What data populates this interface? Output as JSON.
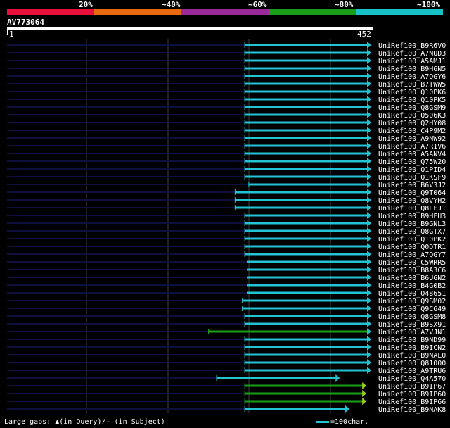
{
  "identity_scale": {
    "ticks": [
      "20%",
      "~40%",
      "~60%",
      "~80%",
      "~100%"
    ],
    "colors": [
      "#e8103a",
      "#e86a10",
      "#9a2a9a",
      "#1a9e1a",
      "#19c2c8"
    ]
  },
  "query": {
    "id": "AV773064",
    "start": "1",
    "end": "452",
    "length": 452
  },
  "hits": [
    {
      "name": "UniRef100_B9R6V0",
      "start": 295,
      "end": 452,
      "color": "#22c4d4",
      "arrow": "#22c4d4"
    },
    {
      "name": "UniRef100_A7NUD3",
      "start": 295,
      "end": 452,
      "color": "#22c4d4",
      "arrow": "#22c4d4"
    },
    {
      "name": "UniRef100_A5AMJ1",
      "start": 295,
      "end": 452,
      "color": "#22c4d4",
      "arrow": "#22c4d4"
    },
    {
      "name": "UniRef100_B9H6N5",
      "start": 295,
      "end": 452,
      "color": "#22c4d4",
      "arrow": "#22c4d4"
    },
    {
      "name": "UniRef100_A7QGY6",
      "start": 295,
      "end": 452,
      "color": "#22c4d4",
      "arrow": "#22c4d4"
    },
    {
      "name": "UniRef100_B7TWW5",
      "start": 295,
      "end": 452,
      "color": "#22c4d4",
      "arrow": "#22c4d4"
    },
    {
      "name": "UniRef100_Q10PK6",
      "start": 295,
      "end": 452,
      "color": "#22c4d4",
      "arrow": "#22c4d4"
    },
    {
      "name": "UniRef100_Q10PK5",
      "start": 295,
      "end": 452,
      "color": "#22c4d4",
      "arrow": "#22c4d4"
    },
    {
      "name": "UniRef100_Q8GSM9",
      "start": 295,
      "end": 452,
      "color": "#22c4d4",
      "arrow": "#22c4d4"
    },
    {
      "name": "UniRef100_Q506K3",
      "start": 295,
      "end": 452,
      "color": "#22c4d4",
      "arrow": "#22c4d4"
    },
    {
      "name": "UniRef100_Q2HY08",
      "start": 295,
      "end": 452,
      "color": "#22c4d4",
      "arrow": "#22c4d4"
    },
    {
      "name": "UniRef100_C4P9M2",
      "start": 295,
      "end": 452,
      "color": "#22c4d4",
      "arrow": "#22c4d4"
    },
    {
      "name": "UniRef100_A9NW92",
      "start": 295,
      "end": 452,
      "color": "#22c4d4",
      "arrow": "#22c4d4"
    },
    {
      "name": "UniRef100_A7R1V6",
      "start": 295,
      "end": 452,
      "color": "#22c4d4",
      "arrow": "#22c4d4"
    },
    {
      "name": "UniRef100_A5ANV4",
      "start": 295,
      "end": 452,
      "color": "#22c4d4",
      "arrow": "#22c4d4"
    },
    {
      "name": "UniRef100_Q75W20",
      "start": 295,
      "end": 452,
      "color": "#22c4d4",
      "arrow": "#22c4d4"
    },
    {
      "name": "UniRef100_Q1PID4",
      "start": 295,
      "end": 452,
      "color": "#22c4d4",
      "arrow": "#22c4d4"
    },
    {
      "name": "UniRef100_Q1KSF9",
      "start": 295,
      "end": 452,
      "color": "#22c4d4",
      "arrow": "#22c4d4"
    },
    {
      "name": "UniRef100_B6V3J2",
      "start": 300,
      "end": 452,
      "color": "#22c4d4",
      "arrow": "#22c4d4"
    },
    {
      "name": "UniRef100_Q9T064",
      "start": 283,
      "end": 452,
      "color": "#22c4d4",
      "arrow": "#22c4d4"
    },
    {
      "name": "UniRef100_Q8VYH2",
      "start": 283,
      "end": 452,
      "color": "#22c4d4",
      "arrow": "#22c4d4"
    },
    {
      "name": "UniRef100_Q8LFJ1",
      "start": 283,
      "end": 452,
      "color": "#22c4d4",
      "arrow": "#22c4d4"
    },
    {
      "name": "UniRef100_B9HFU3",
      "start": 295,
      "end": 452,
      "color": "#22c4d4",
      "arrow": "#22c4d4"
    },
    {
      "name": "UniRef100_B9GNL3",
      "start": 295,
      "end": 452,
      "color": "#22c4d4",
      "arrow": "#22c4d4"
    },
    {
      "name": "UniRef100_Q8GTX7",
      "start": 295,
      "end": 452,
      "color": "#22c4d4",
      "arrow": "#22c4d4"
    },
    {
      "name": "UniRef100_Q10PK2",
      "start": 295,
      "end": 452,
      "color": "#22c4d4",
      "arrow": "#22c4d4"
    },
    {
      "name": "UniRef100_Q0DTR1",
      "start": 295,
      "end": 452,
      "color": "#22c4d4",
      "arrow": "#22c4d4"
    },
    {
      "name": "UniRef100_A7QGY7",
      "start": 295,
      "end": 452,
      "color": "#22c4d4",
      "arrow": "#22c4d4"
    },
    {
      "name": "UniRef100_C5WRR5",
      "start": 298,
      "end": 452,
      "color": "#22c4d4",
      "arrow": "#22c4d4"
    },
    {
      "name": "UniRef100_B8A3C6",
      "start": 298,
      "end": 452,
      "color": "#22c4d4",
      "arrow": "#22c4d4"
    },
    {
      "name": "UniRef100_B6U6N2",
      "start": 298,
      "end": 452,
      "color": "#22c4d4",
      "arrow": "#22c4d4"
    },
    {
      "name": "UniRef100_B4G0B2",
      "start": 298,
      "end": 452,
      "color": "#22c4d4",
      "arrow": "#22c4d4"
    },
    {
      "name": "UniRef100_O48651",
      "start": 298,
      "end": 452,
      "color": "#22c4d4",
      "arrow": "#22c4d4"
    },
    {
      "name": "UniRef100_Q9SM02",
      "start": 292,
      "end": 452,
      "color": "#22c4d4",
      "arrow": "#22c4d4"
    },
    {
      "name": "UniRef100_Q9C649",
      "start": 292,
      "end": 452,
      "color": "#22c4d4",
      "arrow": "#22c4d4"
    },
    {
      "name": "UniRef100_Q8GSM8",
      "start": 295,
      "end": 452,
      "color": "#22c4d4",
      "arrow": "#22c4d4"
    },
    {
      "name": "UniRef100_B9SX91",
      "start": 295,
      "end": 452,
      "color": "#22c4d4",
      "arrow": "#22c4d4"
    },
    {
      "name": "UniRef100_A7VJN1",
      "start": 250,
      "end": 452,
      "color": "#1a9e1a",
      "arrow": "#22c4d4"
    },
    {
      "name": "UniRef100_B9ND99",
      "start": 295,
      "end": 452,
      "color": "#22c4d4",
      "arrow": "#22c4d4"
    },
    {
      "name": "UniRef100_B9ICN2",
      "start": 295,
      "end": 452,
      "color": "#22c4d4",
      "arrow": "#22c4d4"
    },
    {
      "name": "UniRef100_B9NAL0",
      "start": 295,
      "end": 452,
      "color": "#22c4d4",
      "arrow": "#22c4d4"
    },
    {
      "name": "UniRef100_Q81000",
      "start": 295,
      "end": 452,
      "color": "#22c4d4",
      "arrow": "#22c4d4"
    },
    {
      "name": "UniRef100_A9TRU6",
      "start": 295,
      "end": 452,
      "color": "#22c4d4",
      "arrow": "#22c4d4"
    },
    {
      "name": "UniRef100_Q4A570",
      "start": 260,
      "end": 413,
      "color": "#22c4d4",
      "arrow": "#22c4d4"
    },
    {
      "name": "UniRef100_B9IP67",
      "start": 295,
      "end": 446,
      "color": "#1a9e1a",
      "arrow": "#9ec81a"
    },
    {
      "name": "UniRef100_B9IP60",
      "start": 295,
      "end": 446,
      "color": "#1a9e1a",
      "arrow": "#9ec81a"
    },
    {
      "name": "UniRef100_B9IP66",
      "start": 295,
      "end": 446,
      "color": "#1a9e1a",
      "arrow": "#9ec81a"
    },
    {
      "name": "UniRef100_B9NAK8",
      "start": 295,
      "end": 425,
      "color": "#22c4d4",
      "arrow": "#22c4d4"
    }
  ],
  "footer": {
    "text": "Large gaps: ▲(in Query)/- (in Subject)"
  },
  "legend": {
    "text": "=100char."
  },
  "colors": {
    "query_line": "#101040",
    "grid": "#404040"
  }
}
